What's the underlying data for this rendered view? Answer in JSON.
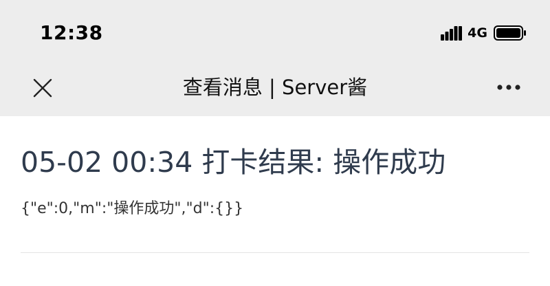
{
  "status_bar": {
    "time": "12:38",
    "network": "4G",
    "icons": [
      "signal-bars-icon",
      "battery-icon"
    ]
  },
  "nav_bar": {
    "title": "查看消息 | Server酱",
    "close_icon": "close-icon",
    "more_icon": "more-icon"
  },
  "message": {
    "title": "05-02 00:34 打卡结果: 操作成功",
    "body": "{\"e\":0,\"m\":\"操作成功\",\"d\":{}}"
  },
  "colors": {
    "header_bg": "#ededed",
    "title_text": "#2f3b4d",
    "body_text": "#333333"
  }
}
